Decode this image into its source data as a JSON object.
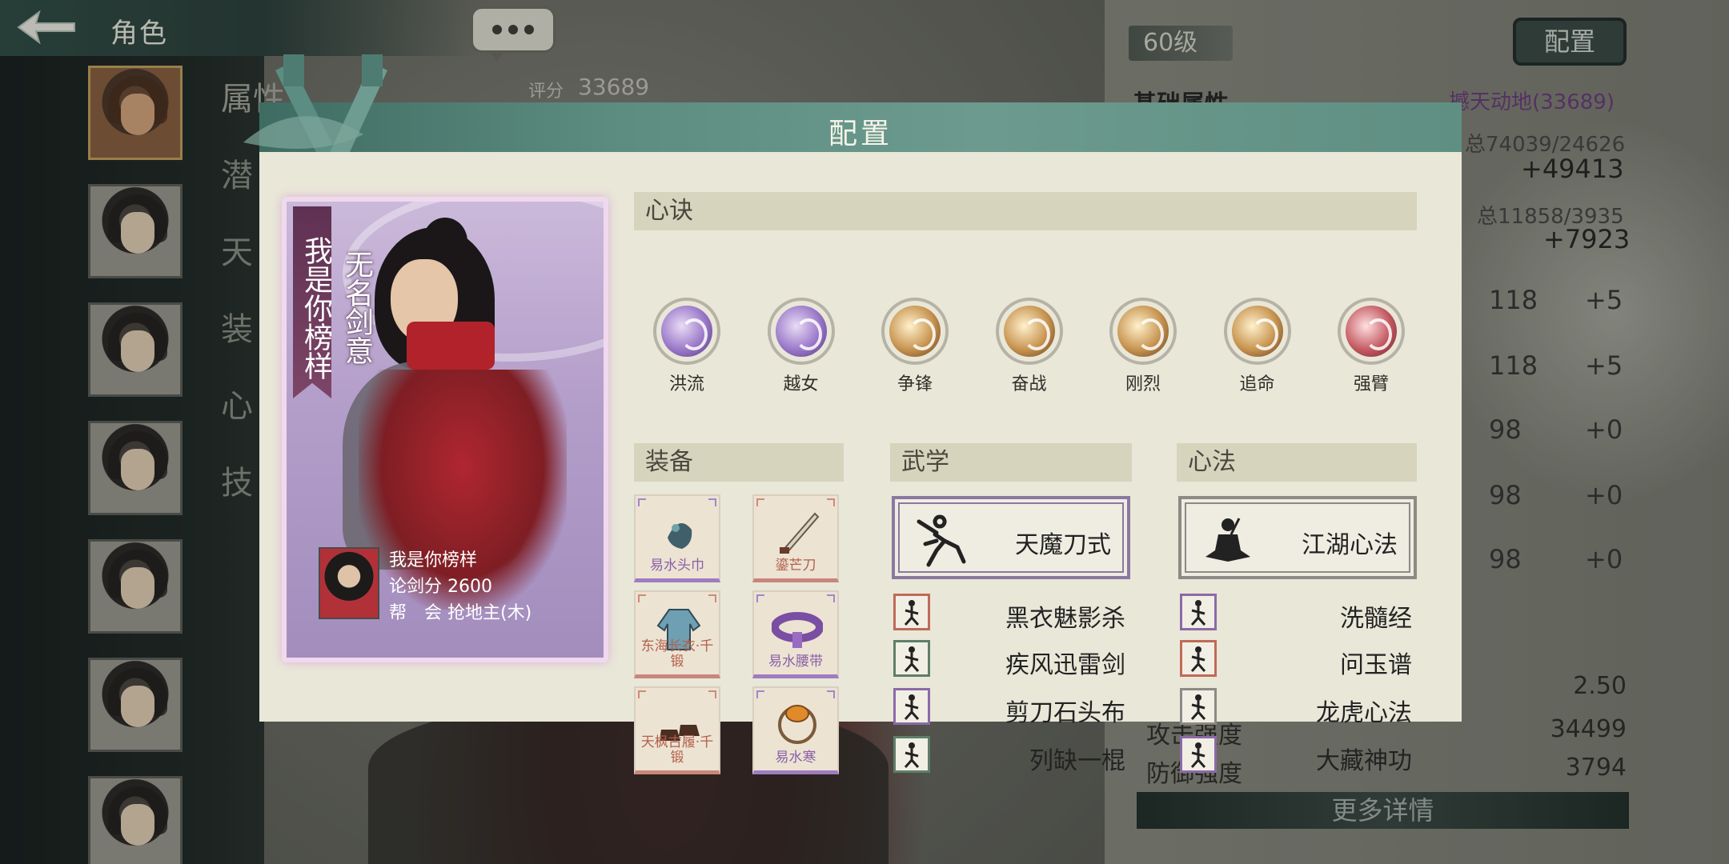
{
  "header": {
    "title": "角色"
  },
  "left_labels": [
    "属性",
    "潜",
    "天",
    "装",
    "心",
    "技"
  ],
  "right_panel": {
    "level": "60级",
    "config_button": "配置",
    "score_label": "评分",
    "score_value": "33689",
    "base_attr_title": "基础属性",
    "rank_text": "撼天动地(33689)",
    "total1": "总74039/24626",
    "bonus1": "+49413",
    "total2": "总11858/3935",
    "bonus2": "+7923",
    "stats": [
      {
        "value": "118",
        "delta": "+5"
      },
      {
        "value": "118",
        "delta": "+5"
      },
      {
        "value": "98",
        "delta": "+0"
      },
      {
        "value": "98",
        "delta": "+0"
      },
      {
        "value": "98",
        "delta": "+0"
      }
    ],
    "stat_2_50": "2.50",
    "attack_label": "攻击强度",
    "attack_value": "34499",
    "defense_label": "防御强度",
    "defense_value": "3794",
    "more_button": "更多详情"
  },
  "modal": {
    "title": "配置",
    "card": {
      "motto": "我是你榜样",
      "sword_intent": "无名剑意",
      "name_line": "我是你榜样",
      "score_line": "论剑分 2600",
      "guild_line": "帮　会 抢地主(木)"
    },
    "sections": {
      "xinjue": "心诀",
      "equip": "装备",
      "wuxue": "武学",
      "xinfa": "心法"
    },
    "xinjue": [
      {
        "label": "洪流",
        "icon": "vortex-icon",
        "tone": "purple"
      },
      {
        "label": "越女",
        "icon": "crescent-slash-icon",
        "tone": "purple"
      },
      {
        "label": "争锋",
        "icon": "fist-strike-icon",
        "tone": "gold"
      },
      {
        "label": "奋战",
        "icon": "warrior-icon",
        "tone": "gold"
      },
      {
        "label": "刚烈",
        "icon": "fierce-face-icon",
        "tone": "gold"
      },
      {
        "label": "追命",
        "icon": "dash-icon",
        "tone": "gold"
      },
      {
        "label": "强臂",
        "icon": "strong-arm-icon",
        "tone": "red"
      }
    ],
    "equipment": [
      {
        "name": "易水头巾",
        "tone": "purple",
        "icon": "headscarf-icon"
      },
      {
        "name": "鎏芒刀",
        "tone": "red",
        "icon": "saber-icon"
      },
      {
        "name": "东海长衣·千锻",
        "tone": "red",
        "icon": "robe-icon"
      },
      {
        "name": "易水腰带",
        "tone": "purple",
        "icon": "belt-icon"
      },
      {
        "name": "天枫古履·千锻",
        "tone": "red",
        "icon": "boots-icon"
      },
      {
        "name": "易水寒",
        "tone": "purple",
        "icon": "bracelet-icon"
      }
    ],
    "wuxue_main": "天魔刀式",
    "wuxue_list": [
      {
        "label": "黑衣魅影杀",
        "tone": "red"
      },
      {
        "label": "疾风迅雷剑",
        "tone": "green"
      },
      {
        "label": "剪刀石头布",
        "tone": "purple"
      },
      {
        "label": "列缺一棍",
        "tone": "green"
      }
    ],
    "xinfa_main": "江湖心法",
    "xinfa_list": [
      {
        "label": "洗髓经",
        "tone": "purple"
      },
      {
        "label": "问玉谱",
        "tone": "red"
      },
      {
        "label": "龙虎心法",
        "tone": "gray"
      },
      {
        "label": "大藏神功",
        "tone": "purple"
      }
    ],
    "tone_colors": {
      "purple": "#8c6aa8",
      "red": "#c06a58",
      "green": "#5f7e6a",
      "gray": "#8b8a84"
    }
  }
}
